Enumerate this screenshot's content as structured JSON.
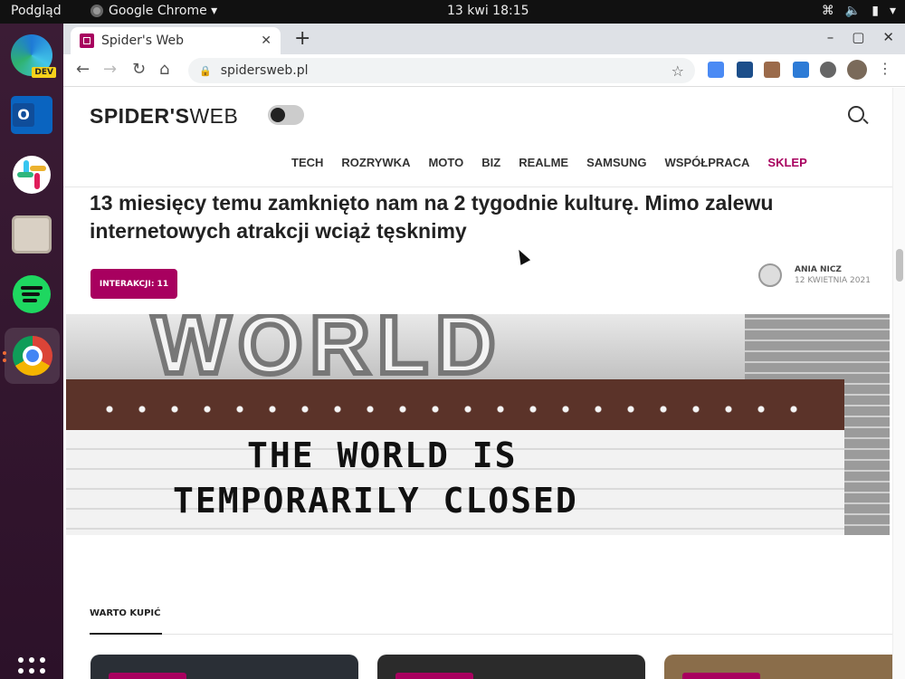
{
  "topbar": {
    "activities": "Podgląd",
    "app_name": "Google Chrome ▾",
    "clock": "13 kwi  18:15",
    "tray": [
      "⌘",
      "🔈",
      "▮",
      "▾"
    ]
  },
  "dock": {
    "edge_badge": "DEV",
    "outlook_letter": "O"
  },
  "browser": {
    "tab_title": "Spider's Web",
    "tab_close": "✕",
    "new_tab": "+",
    "window_controls": [
      "–",
      "▢",
      "✕"
    ],
    "back": "←",
    "forward": "→",
    "reload": "↻",
    "home": "⌂",
    "lock": "🔒",
    "url": "spidersweb.pl",
    "star": "☆",
    "menu": "⋮"
  },
  "site": {
    "logo_bold": "SPIDER'S",
    "logo_light": "WEB",
    "nav": [
      "TECH",
      "ROZRYWKA",
      "MOTO",
      "BIZ",
      "REALME",
      "SAMSUNG",
      "WSPÓŁPRACA",
      "SKLEP"
    ]
  },
  "article": {
    "headline": "13 miesięcy temu zamknięto nam na 2 tygodnie kulturę. Mimo zalewu internetowych atrakcji wciąż tęsknimy",
    "interactions": "INTERAKCJI: 11",
    "author": "ANIA NICZ",
    "date": "12 KWIETNIA 2021",
    "hero_sign_top": "WORLD",
    "hero_line1": "THE WORLD IS",
    "hero_line2": "TEMPORARILY CLOSED"
  },
  "section": {
    "title": "WARTO KUPIĆ"
  },
  "colors": {
    "accent": "#a8005f",
    "dock_bg": "#2c1129",
    "topbar_bg": "#111111"
  }
}
